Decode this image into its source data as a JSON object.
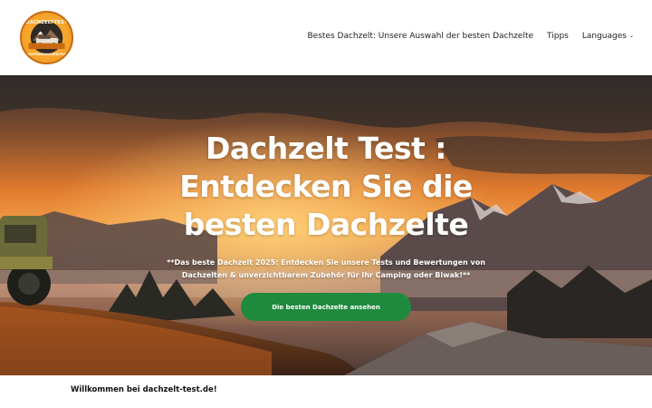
{
  "logo": {
    "top_text": "DACHZELT-TEST",
    "bottom_text": "ABENTEUERAUSRÜSTUNG"
  },
  "nav": {
    "items": [
      {
        "label": "Bestes Dachzelt: Unsere Auswahl der besten Dachzelte"
      },
      {
        "label": "Tipps"
      },
      {
        "label": "Languages"
      }
    ]
  },
  "hero": {
    "title_line1": "Dachzelt Test :",
    "title_line2": "Entdecken Sie die",
    "title_line3": "besten Dachzelte",
    "subtitle": "**Das beste Dachzelt 2025: Entdecken Sie unsere Tests und Bewertungen von Dachzelten & unverzichtbarem Zubehör für Ihr Camping oder Biwak!**",
    "cta_label": "Die besten Dachzelte ansehen"
  },
  "main": {
    "welcome": "Willkommen bei dachzelt-test.de!"
  },
  "colors": {
    "accent_green": "#1f8a3e",
    "logo_orange": "#f2a12a",
    "sky_orange": "#e8762a"
  }
}
